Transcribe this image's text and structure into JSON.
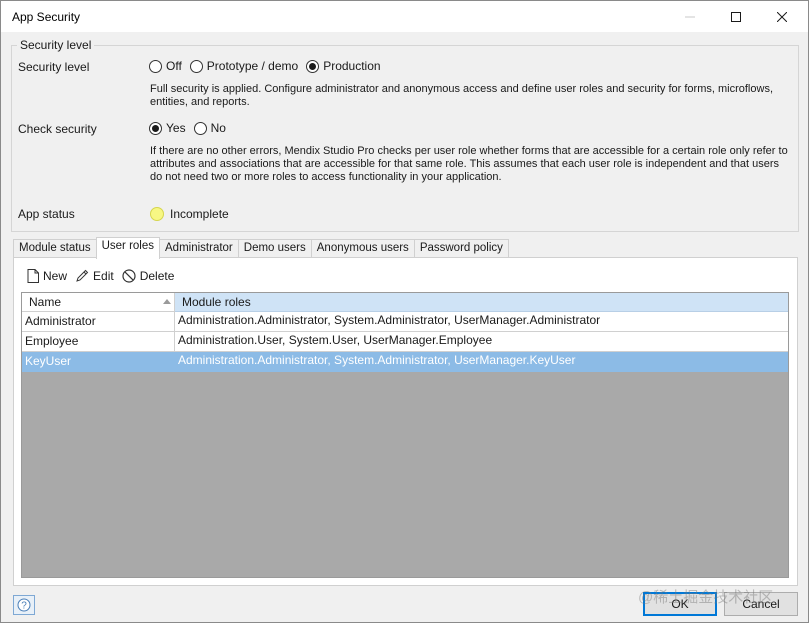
{
  "window": {
    "title": "App Security"
  },
  "security_level_group": {
    "legend": "Security level",
    "security_level_label": "Security level",
    "options": [
      "Off",
      "Prototype / demo",
      "Production"
    ],
    "selected": "Production",
    "description": "Full security is applied. Configure administrator and anonymous access and define user roles and security for forms, microflows, entities, and reports.",
    "check_security_label": "Check security",
    "check_options": [
      "Yes",
      "No"
    ],
    "check_selected": "Yes",
    "check_description": "If there are no other errors, Mendix Studio Pro checks per user role whether forms that are accessible for a certain role only refer to attributes and associations that are accessible for that same role. This assumes that each user role is independent and that users do not need two or more roles to access functionality in your application.",
    "app_status_label": "App status",
    "app_status_value": "Incomplete",
    "app_status_color": "#f7f784"
  },
  "tabs": [
    "Module status",
    "User roles",
    "Administrator",
    "Demo users",
    "Anonymous users",
    "Password policy"
  ],
  "active_tab": "User roles",
  "toolbar": {
    "new_label": "New",
    "edit_label": "Edit",
    "delete_label": "Delete"
  },
  "grid": {
    "columns": [
      "Name",
      "Module roles"
    ],
    "rows": [
      {
        "name": "Administrator",
        "roles": "Administration.Administrator, System.Administrator, UserManager.Administrator"
      },
      {
        "name": "Employee",
        "roles": "Administration.User, System.User, UserManager.Employee"
      },
      {
        "name": "KeyUser",
        "roles": "Administration.Administrator, System.Administrator, UserManager.KeyUser"
      }
    ],
    "selected_row": "KeyUser",
    "selection_color": "#8cbbe6"
  },
  "footer": {
    "ok_label": "OK",
    "cancel_label": "Cancel",
    "watermark": "@稀土掘金技术社区"
  }
}
